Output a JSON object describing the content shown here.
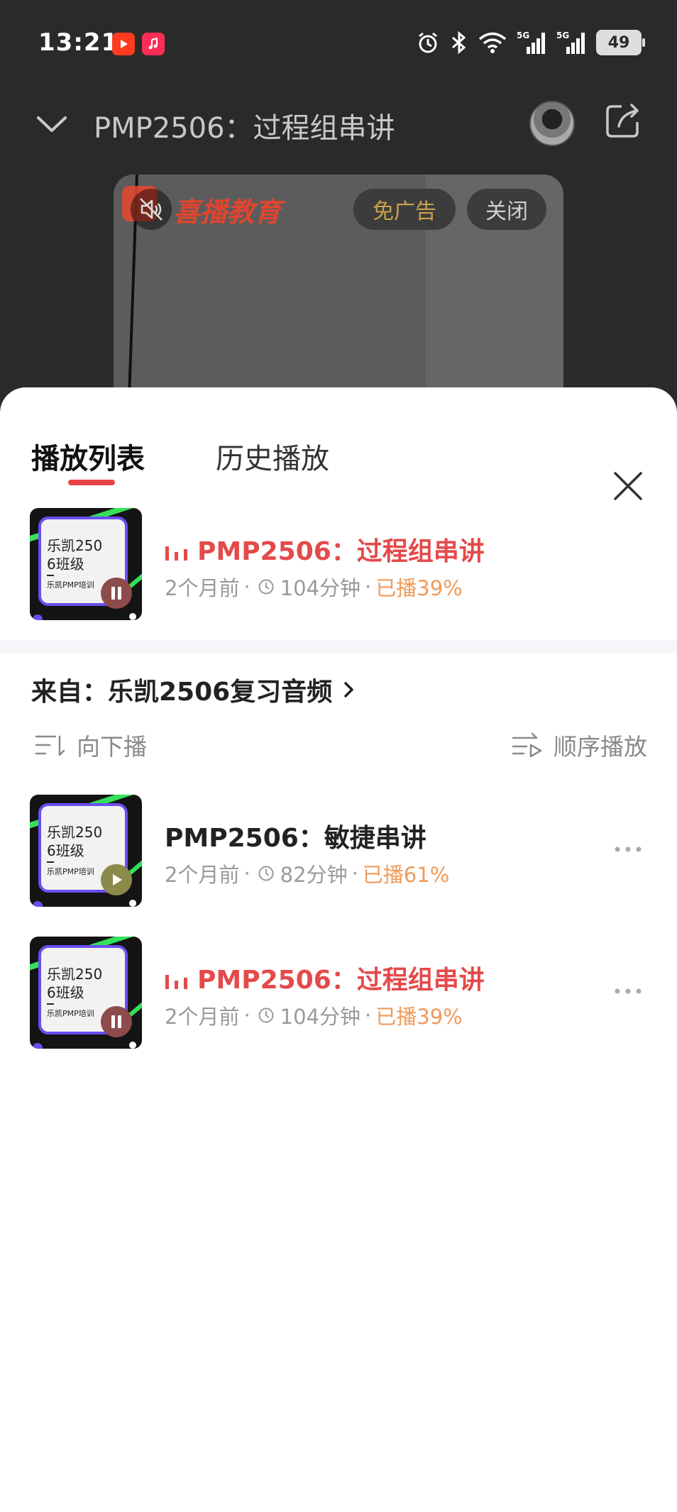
{
  "status_bar": {
    "time": "13:21",
    "battery": "49",
    "network_labels": [
      "5G",
      "5G"
    ]
  },
  "header": {
    "title": "PMP2506：过程组串讲"
  },
  "ad": {
    "brand": "喜播教育",
    "no_ad_button": "免广告",
    "close_button": "关闭"
  },
  "sheet": {
    "tabs": [
      "播放列表",
      "历史播放"
    ],
    "current": {
      "cover_line1": "乐凯250",
      "cover_line2": "6班级",
      "cover_sub": "乐凯PMP培训",
      "title": "PMP2506：过程组串讲",
      "age": "2个月前",
      "duration": "104分钟",
      "played": "已播39%"
    },
    "source_label": "来自：乐凯2506复习音频",
    "controls": {
      "next_mode": "向下播",
      "order_mode": "顺序播放"
    },
    "tracks": [
      {
        "title": "PMP2506：敏捷串讲",
        "age": "2个月前",
        "duration": "82分钟",
        "played": "已播61%",
        "cover_line1": "乐凯250",
        "cover_line2": "6班级",
        "cover_sub": "乐凯PMP培训"
      },
      {
        "title": "PMP2506：过程组串讲",
        "age": "2个月前",
        "duration": "104分钟",
        "played": "已播39%",
        "cover_line1": "乐凯250",
        "cover_line2": "6班级",
        "cover_sub": "乐凯PMP培训"
      }
    ]
  },
  "colors": {
    "accent_red": "#e44a4a",
    "played_orange": "#f09a5a",
    "cover_border": "#6a4ef0"
  }
}
